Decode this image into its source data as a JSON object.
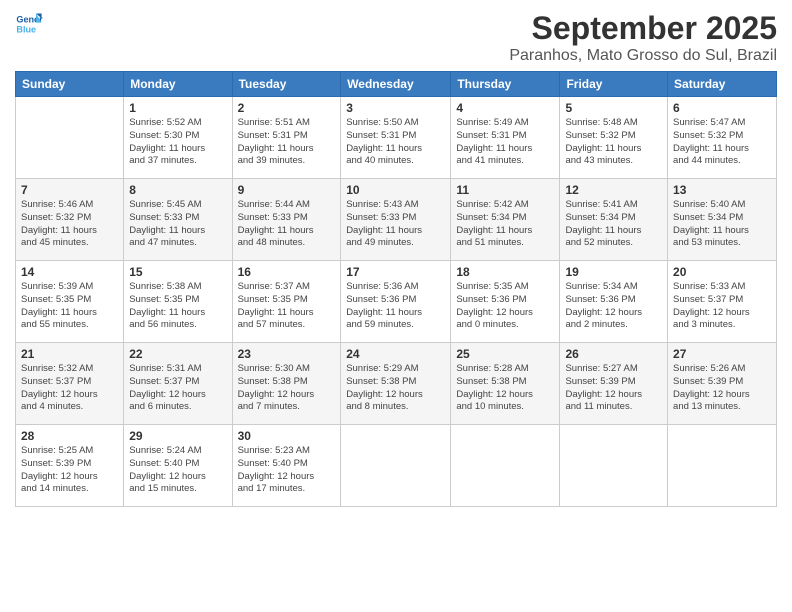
{
  "header": {
    "logo_line1": "General",
    "logo_line2": "Blue",
    "title": "September 2025",
    "location": "Paranhos, Mato Grosso do Sul, Brazil"
  },
  "weekdays": [
    "Sunday",
    "Monday",
    "Tuesday",
    "Wednesday",
    "Thursday",
    "Friday",
    "Saturday"
  ],
  "weeks": [
    [
      {
        "day": "",
        "info": ""
      },
      {
        "day": "1",
        "info": "Sunrise: 5:52 AM\nSunset: 5:30 PM\nDaylight: 11 hours\nand 37 minutes."
      },
      {
        "day": "2",
        "info": "Sunrise: 5:51 AM\nSunset: 5:31 PM\nDaylight: 11 hours\nand 39 minutes."
      },
      {
        "day": "3",
        "info": "Sunrise: 5:50 AM\nSunset: 5:31 PM\nDaylight: 11 hours\nand 40 minutes."
      },
      {
        "day": "4",
        "info": "Sunrise: 5:49 AM\nSunset: 5:31 PM\nDaylight: 11 hours\nand 41 minutes."
      },
      {
        "day": "5",
        "info": "Sunrise: 5:48 AM\nSunset: 5:32 PM\nDaylight: 11 hours\nand 43 minutes."
      },
      {
        "day": "6",
        "info": "Sunrise: 5:47 AM\nSunset: 5:32 PM\nDaylight: 11 hours\nand 44 minutes."
      }
    ],
    [
      {
        "day": "7",
        "info": "Sunrise: 5:46 AM\nSunset: 5:32 PM\nDaylight: 11 hours\nand 45 minutes."
      },
      {
        "day": "8",
        "info": "Sunrise: 5:45 AM\nSunset: 5:33 PM\nDaylight: 11 hours\nand 47 minutes."
      },
      {
        "day": "9",
        "info": "Sunrise: 5:44 AM\nSunset: 5:33 PM\nDaylight: 11 hours\nand 48 minutes."
      },
      {
        "day": "10",
        "info": "Sunrise: 5:43 AM\nSunset: 5:33 PM\nDaylight: 11 hours\nand 49 minutes."
      },
      {
        "day": "11",
        "info": "Sunrise: 5:42 AM\nSunset: 5:34 PM\nDaylight: 11 hours\nand 51 minutes."
      },
      {
        "day": "12",
        "info": "Sunrise: 5:41 AM\nSunset: 5:34 PM\nDaylight: 11 hours\nand 52 minutes."
      },
      {
        "day": "13",
        "info": "Sunrise: 5:40 AM\nSunset: 5:34 PM\nDaylight: 11 hours\nand 53 minutes."
      }
    ],
    [
      {
        "day": "14",
        "info": "Sunrise: 5:39 AM\nSunset: 5:35 PM\nDaylight: 11 hours\nand 55 minutes."
      },
      {
        "day": "15",
        "info": "Sunrise: 5:38 AM\nSunset: 5:35 PM\nDaylight: 11 hours\nand 56 minutes."
      },
      {
        "day": "16",
        "info": "Sunrise: 5:37 AM\nSunset: 5:35 PM\nDaylight: 11 hours\nand 57 minutes."
      },
      {
        "day": "17",
        "info": "Sunrise: 5:36 AM\nSunset: 5:36 PM\nDaylight: 11 hours\nand 59 minutes."
      },
      {
        "day": "18",
        "info": "Sunrise: 5:35 AM\nSunset: 5:36 PM\nDaylight: 12 hours\nand 0 minutes."
      },
      {
        "day": "19",
        "info": "Sunrise: 5:34 AM\nSunset: 5:36 PM\nDaylight: 12 hours\nand 2 minutes."
      },
      {
        "day": "20",
        "info": "Sunrise: 5:33 AM\nSunset: 5:37 PM\nDaylight: 12 hours\nand 3 minutes."
      }
    ],
    [
      {
        "day": "21",
        "info": "Sunrise: 5:32 AM\nSunset: 5:37 PM\nDaylight: 12 hours\nand 4 minutes."
      },
      {
        "day": "22",
        "info": "Sunrise: 5:31 AM\nSunset: 5:37 PM\nDaylight: 12 hours\nand 6 minutes."
      },
      {
        "day": "23",
        "info": "Sunrise: 5:30 AM\nSunset: 5:38 PM\nDaylight: 12 hours\nand 7 minutes."
      },
      {
        "day": "24",
        "info": "Sunrise: 5:29 AM\nSunset: 5:38 PM\nDaylight: 12 hours\nand 8 minutes."
      },
      {
        "day": "25",
        "info": "Sunrise: 5:28 AM\nSunset: 5:38 PM\nDaylight: 12 hours\nand 10 minutes."
      },
      {
        "day": "26",
        "info": "Sunrise: 5:27 AM\nSunset: 5:39 PM\nDaylight: 12 hours\nand 11 minutes."
      },
      {
        "day": "27",
        "info": "Sunrise: 5:26 AM\nSunset: 5:39 PM\nDaylight: 12 hours\nand 13 minutes."
      }
    ],
    [
      {
        "day": "28",
        "info": "Sunrise: 5:25 AM\nSunset: 5:39 PM\nDaylight: 12 hours\nand 14 minutes."
      },
      {
        "day": "29",
        "info": "Sunrise: 5:24 AM\nSunset: 5:40 PM\nDaylight: 12 hours\nand 15 minutes."
      },
      {
        "day": "30",
        "info": "Sunrise: 5:23 AM\nSunset: 5:40 PM\nDaylight: 12 hours\nand 17 minutes."
      },
      {
        "day": "",
        "info": ""
      },
      {
        "day": "",
        "info": ""
      },
      {
        "day": "",
        "info": ""
      },
      {
        "day": "",
        "info": ""
      }
    ]
  ]
}
